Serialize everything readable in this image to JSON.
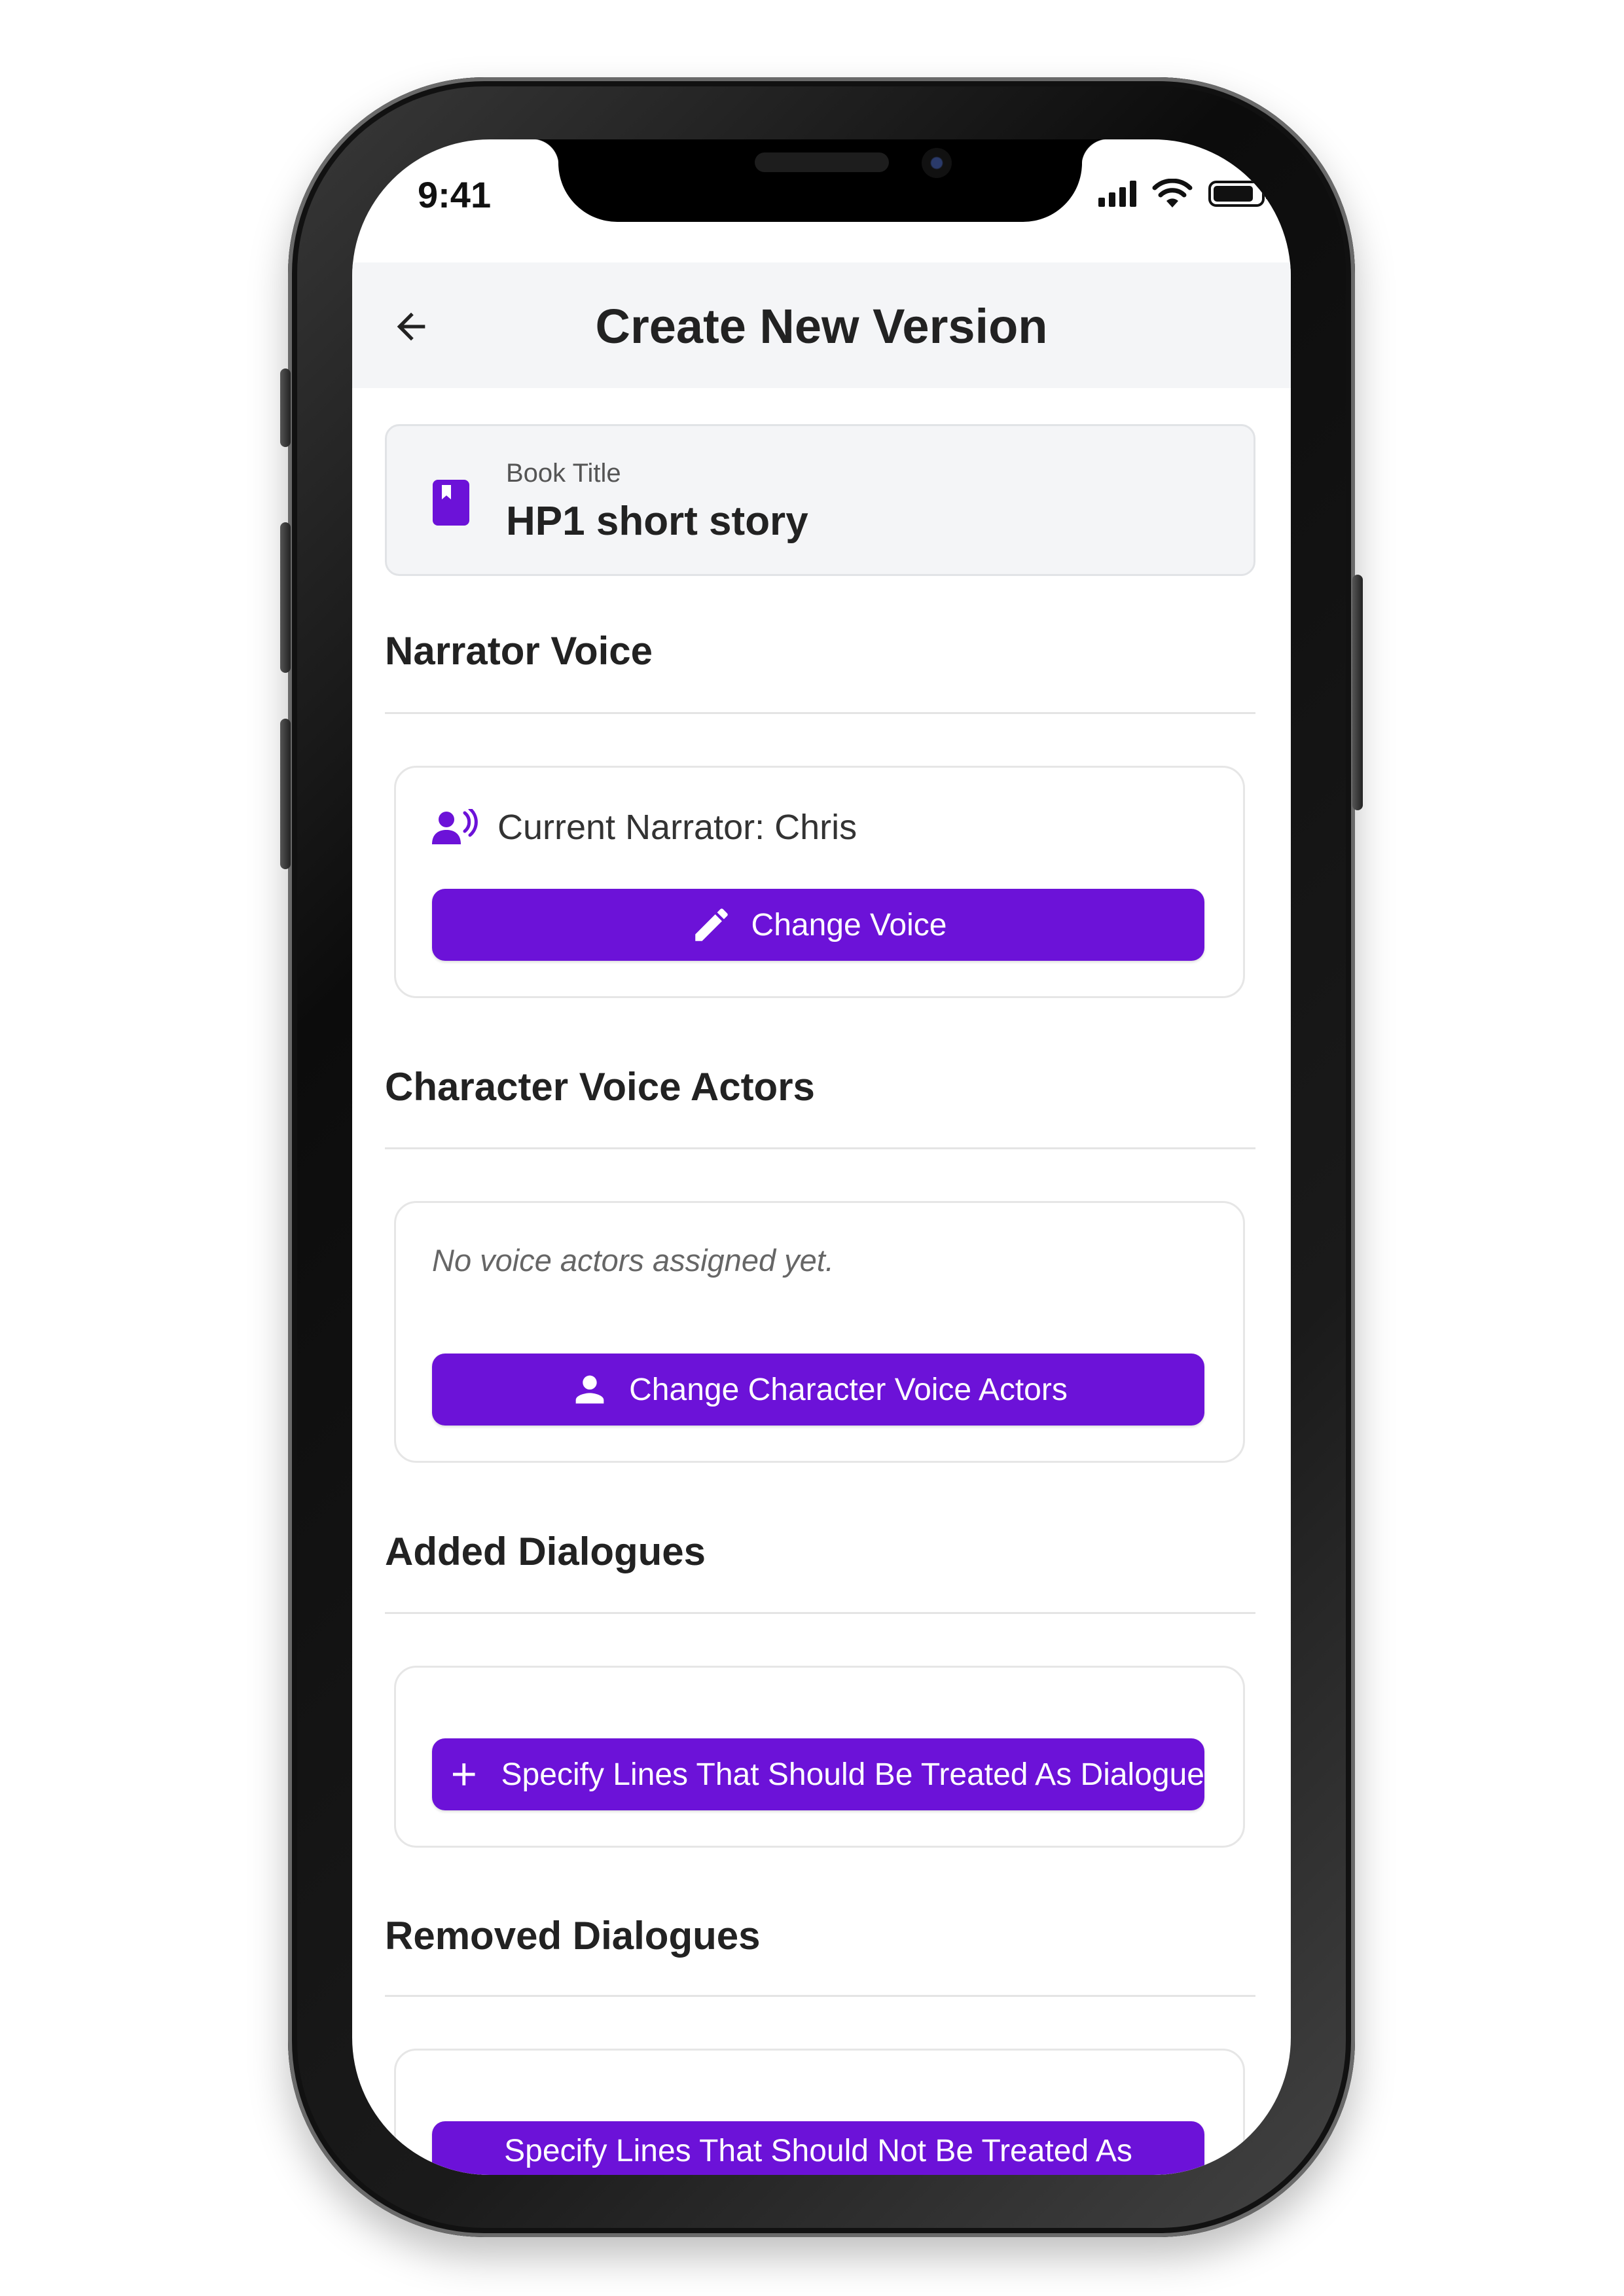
{
  "status_bar": {
    "time": "9:41"
  },
  "header": {
    "title": "Create New Version"
  },
  "book": {
    "label": "Book Title",
    "value": "HP1 short story"
  },
  "narrator": {
    "section_title": "Narrator Voice",
    "current": "Current Narrator: Chris",
    "button_label": "Change Voice"
  },
  "characters": {
    "section_title": "Character Voice Actors",
    "empty_text": "No voice actors assigned yet.",
    "button_label": "Change Character Voice Actors"
  },
  "added": {
    "section_title": "Added Dialogues",
    "button_label": "Specify Lines That Should Be Treated As Dialogue"
  },
  "removed": {
    "section_title": "Removed Dialogues",
    "button_label": "Specify Lines That Should Not Be Treated As"
  },
  "colors": {
    "accent": "#6c12d8",
    "header_bg": "#f4f5f7",
    "text": "#222222"
  },
  "icons": [
    "back-arrow-icon",
    "book-icon",
    "narrator-voice-icon",
    "pencil-icon",
    "person-icon",
    "plus-icon",
    "signal-icon",
    "wifi-icon",
    "battery-icon"
  ]
}
